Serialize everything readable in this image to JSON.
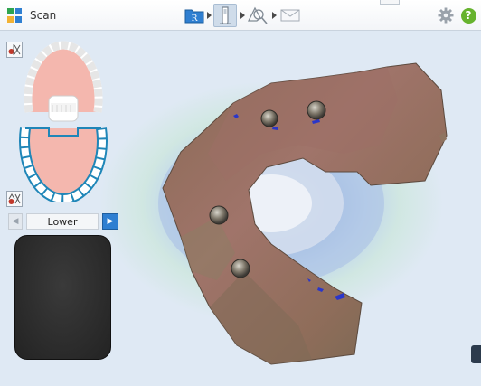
{
  "app": {
    "title": "Scan"
  },
  "toolbar": {
    "buttons": [
      {
        "name": "rx-button",
        "icon": "folder-rx-icon",
        "letter": "R"
      },
      {
        "name": "scan-button",
        "icon": "scanner-wand-icon",
        "active": true
      },
      {
        "name": "view-button",
        "icon": "view-magnify-icon"
      },
      {
        "name": "send-button",
        "icon": "envelope-icon"
      }
    ],
    "settings_icon": "gear-icon",
    "help_icon": "help-icon",
    "help_glyph": "?"
  },
  "jaw_selector": {
    "upper_icon": "upper-jaw-icon",
    "lower_icon": "lower-jaw-icon",
    "selected": "lower"
  },
  "navigation": {
    "prev_glyph": "◀",
    "label": "Lower",
    "next_glyph": "▶"
  },
  "colors": {
    "accent": "#2f7fd1",
    "help_green": "#66b32e",
    "gum_pink": "#f4b7ae",
    "tooth_outline": "#1f86b8",
    "background": "#dfe9f4"
  }
}
